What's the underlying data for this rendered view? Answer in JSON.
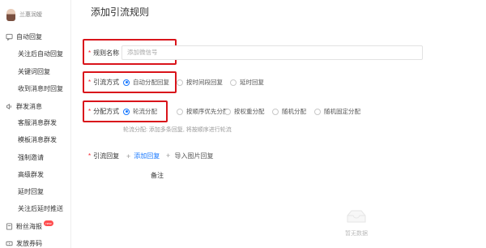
{
  "sidebar": {
    "account_name": "兰惠润嫒",
    "groups": [
      {
        "label": "自动回复",
        "icon": "message-icon"
      },
      {
        "label": "群发消息",
        "icon": "broadcast-icon"
      },
      {
        "label": "粉丝海报",
        "icon": "poster-icon",
        "badge": "new"
      },
      {
        "label": "发放券码",
        "icon": "coupon-icon"
      }
    ],
    "items": [
      "关注后自动回复",
      "关键词回复",
      "收到消息时回复",
      "客服消息群发",
      "模板消息群发",
      "强制邀请",
      "高级群发",
      "延时回复",
      "关注后延时推送"
    ]
  },
  "page": {
    "title": "添加引流规则"
  },
  "form": {
    "required_mark": "*",
    "rule_name": {
      "label": "规则名称",
      "placeholder": "添加微信号"
    },
    "traffic_mode": {
      "label": "引流方式",
      "options": [
        "自动分配回复",
        "按时间段回复",
        "延时回复"
      ],
      "selected": "自动分配回复"
    },
    "assign_mode": {
      "label": "分配方式",
      "options": [
        "轮流分配",
        "按顺序优先分配",
        "按权重分配",
        "随机分配",
        "随机固定分配"
      ],
      "selected": "轮流分配",
      "hint": "轮流分配: 添加多条回复, 将按顺序进行轮流"
    },
    "reply": {
      "label": "引流回复",
      "add_label": "添加回复",
      "import_label": "导入图片回复",
      "plus": "+",
      "column_remark": "备注",
      "empty_text": "暂无数据"
    }
  },
  "colors": {
    "accent": "#1677ff",
    "highlight": "#d9141b",
    "required": "#f5222d"
  }
}
